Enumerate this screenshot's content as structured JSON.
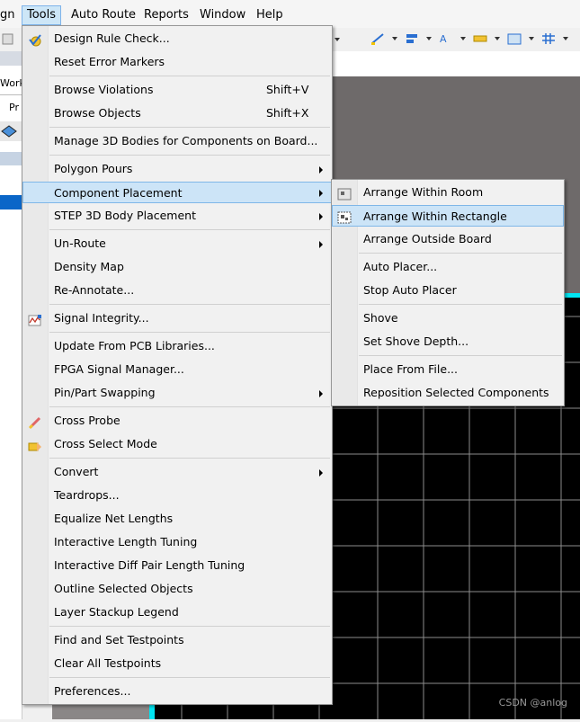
{
  "menubar": {
    "items": [
      {
        "label": "gn"
      },
      {
        "label": "Tools"
      },
      {
        "label": "Auto Route"
      },
      {
        "label": "Reports"
      },
      {
        "label": "Window"
      },
      {
        "label": "Help"
      }
    ]
  },
  "left_panel": {
    "work_label": "Work",
    "pr_label": "Pr"
  },
  "tools_menu": {
    "items": [
      {
        "label": "Design Rule Check...",
        "shortcut": "",
        "icon": "drc-check-icon",
        "submenu": false
      },
      {
        "label": "Reset Error Markers",
        "shortcut": "",
        "icon": "",
        "submenu": false
      },
      {
        "label": "Browse Violations",
        "shortcut": "Shift+V",
        "icon": "",
        "submenu": false
      },
      {
        "label": "Browse Objects",
        "shortcut": "Shift+X",
        "icon": "",
        "submenu": false
      },
      {
        "label": "Manage 3D Bodies for Components on Board...",
        "shortcut": "",
        "icon": "",
        "submenu": false
      },
      {
        "label": "Polygon Pours",
        "shortcut": "",
        "icon": "",
        "submenu": true
      },
      {
        "label": "Component Placement",
        "shortcut": "",
        "icon": "",
        "submenu": true
      },
      {
        "label": "STEP 3D Body Placement",
        "shortcut": "",
        "icon": "",
        "submenu": true
      },
      {
        "label": "Un-Route",
        "shortcut": "",
        "icon": "",
        "submenu": true
      },
      {
        "label": "Density Map",
        "shortcut": "",
        "icon": "",
        "submenu": false
      },
      {
        "label": "Re-Annotate...",
        "shortcut": "",
        "icon": "",
        "submenu": false
      },
      {
        "label": "Signal Integrity...",
        "shortcut": "",
        "icon": "signal-integrity-icon",
        "submenu": false
      },
      {
        "label": "Update From PCB Libraries...",
        "shortcut": "",
        "icon": "",
        "submenu": false
      },
      {
        "label": "FPGA Signal Manager...",
        "shortcut": "",
        "icon": "",
        "submenu": false
      },
      {
        "label": "Pin/Part Swapping",
        "shortcut": "",
        "icon": "",
        "submenu": true
      },
      {
        "label": "Cross Probe",
        "shortcut": "",
        "icon": "cross-probe-icon",
        "submenu": false
      },
      {
        "label": "Cross Select Mode",
        "shortcut": "",
        "icon": "cross-select-icon",
        "submenu": false
      },
      {
        "label": "Convert",
        "shortcut": "",
        "icon": "",
        "submenu": true
      },
      {
        "label": "Teardrops...",
        "shortcut": "",
        "icon": "",
        "submenu": false
      },
      {
        "label": "Equalize Net Lengths",
        "shortcut": "",
        "icon": "",
        "submenu": false
      },
      {
        "label": "Interactive Length Tuning",
        "shortcut": "",
        "icon": "",
        "submenu": false
      },
      {
        "label": "Interactive Diff Pair Length Tuning",
        "shortcut": "",
        "icon": "",
        "submenu": false
      },
      {
        "label": "Outline Selected Objects",
        "shortcut": "",
        "icon": "",
        "submenu": false
      },
      {
        "label": "Layer Stackup Legend",
        "shortcut": "",
        "icon": "",
        "submenu": false
      },
      {
        "label": "Find and Set Testpoints",
        "shortcut": "",
        "icon": "",
        "submenu": false
      },
      {
        "label": "Clear All Testpoints",
        "shortcut": "",
        "icon": "",
        "submenu": false
      },
      {
        "label": "Preferences...",
        "shortcut": "",
        "icon": "",
        "submenu": false
      }
    ],
    "highlighted": "Component Placement"
  },
  "placement_submenu": {
    "items": [
      {
        "label": "Arrange Within Room",
        "icon": "arrange-room-icon"
      },
      {
        "label": "Arrange Within Rectangle",
        "icon": "arrange-rectangle-icon"
      },
      {
        "label": "Arrange Outside Board",
        "icon": ""
      },
      {
        "label": "Auto Placer...",
        "icon": ""
      },
      {
        "label": "Stop Auto Placer",
        "icon": ""
      },
      {
        "label": "Shove",
        "icon": ""
      },
      {
        "label": "Set Shove Depth...",
        "icon": ""
      },
      {
        "label": "Place From File...",
        "icon": ""
      },
      {
        "label": "Reposition Selected Components",
        "icon": ""
      }
    ],
    "highlighted": "Arrange Within Rectangle"
  },
  "watermark": "CSDN @anlog",
  "colors": {
    "highlight_bg": "#cce4f7",
    "highlight_border": "#7fb7e8",
    "canvas_black": "#000000",
    "grid_cyan": "#00e5f2",
    "workspace_gray": "#6e6a6a"
  }
}
